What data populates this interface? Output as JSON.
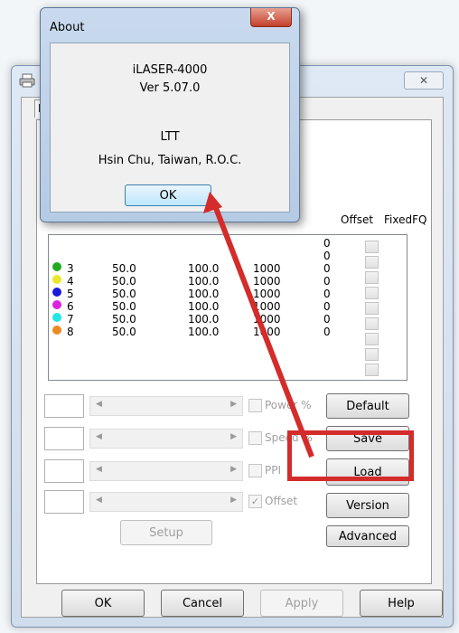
{
  "about_dialog": {
    "title": "About",
    "close_glyph": "X",
    "product": "iLASER-4000",
    "version": "Ver 5.07.0",
    "company": "LTT",
    "location": "Hsin Chu, Taiwan, R.O.C.",
    "ok_label": "OK"
  },
  "main_dialog": {
    "close_glyph": "✕",
    "tab_label": "L",
    "icon": "printer-icon",
    "columns": {
      "offset": "Offset",
      "fixedfq": "FixedFQ"
    },
    "rows": [
      {
        "color": "#22aa22",
        "index": "3",
        "power": "50.0",
        "speed": "100.0",
        "ppi": "1000",
        "offset": "0"
      },
      {
        "color": "#e8e829",
        "index": "4",
        "power": "50.0",
        "speed": "100.0",
        "ppi": "1000",
        "offset": "0"
      },
      {
        "color": "#1a1adf",
        "index": "5",
        "power": "50.0",
        "speed": "100.0",
        "ppi": "1000",
        "offset": "0"
      },
      {
        "color": "#dd22dd",
        "index": "6",
        "power": "50.0",
        "speed": "100.0",
        "ppi": "1000",
        "offset": "0"
      },
      {
        "color": "#22e5e5",
        "index": "7",
        "power": "50.0",
        "speed": "100.0",
        "ppi": "1000",
        "offset": "0"
      },
      {
        "color": "#ee8822",
        "index": "8",
        "power": "50.0",
        "speed": "100.0",
        "ppi": "1000",
        "offset": "0"
      }
    ],
    "hidden_offsets": [
      "0",
      "0"
    ],
    "checkbox_labels": {
      "power": "Power %",
      "speed": "Speed %",
      "ppi": "PPI",
      "offset": "Offset"
    },
    "buttons": {
      "default": "Default",
      "save": "Save",
      "load": "Load",
      "version": "Version",
      "advanced": "Advanced",
      "setup": "Setup",
      "ok": "OK",
      "cancel": "Cancel",
      "apply": "Apply",
      "help": "Help"
    }
  },
  "annotation": {
    "color": "#d42b2b"
  }
}
